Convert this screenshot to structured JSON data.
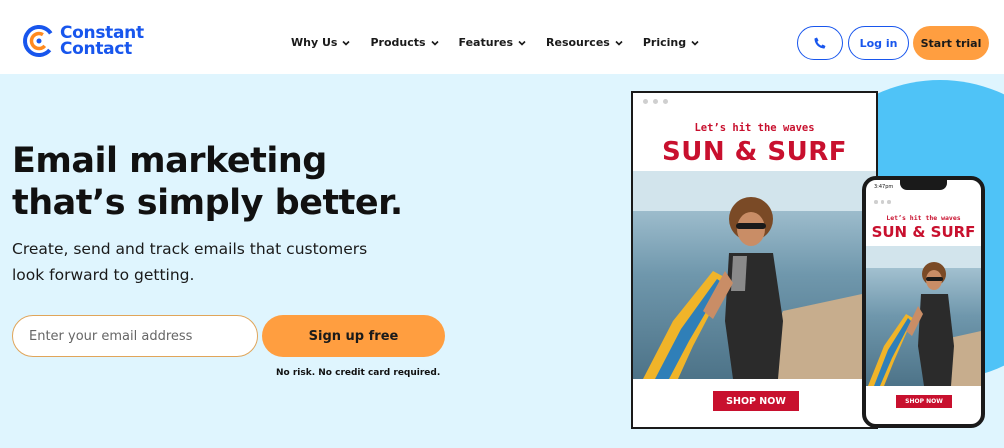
{
  "header": {
    "logo": {
      "line1": "Constant",
      "line2": "Contact",
      "icon": "constant-contact-logo-icon"
    },
    "nav": [
      {
        "label": "Why Us"
      },
      {
        "label": "Products"
      },
      {
        "label": "Features"
      },
      {
        "label": "Resources"
      },
      {
        "label": "Pricing"
      }
    ],
    "phone_icon": "phone-icon",
    "login_label": "Log in",
    "trial_label": "Start trial"
  },
  "hero": {
    "headline": "Email marketing that’s simply better.",
    "subtext": "Create, send and track emails that customers look forward to getting.",
    "email_placeholder": "Enter your email address",
    "signup_label": "Sign up free",
    "disclaimer": "No risk. No credit card required."
  },
  "email_preview": {
    "tagline": "Let’s hit the waves",
    "title": "SUN & SURF",
    "cta": "SHOP NOW",
    "phone_time": "3:47pm"
  },
  "colors": {
    "brand_blue": "#1856ed",
    "cta_orange": "#ff9e40",
    "hero_bg": "#dff5fe",
    "accent_cyan": "#4fc3f7",
    "promo_red": "#c8102e"
  }
}
